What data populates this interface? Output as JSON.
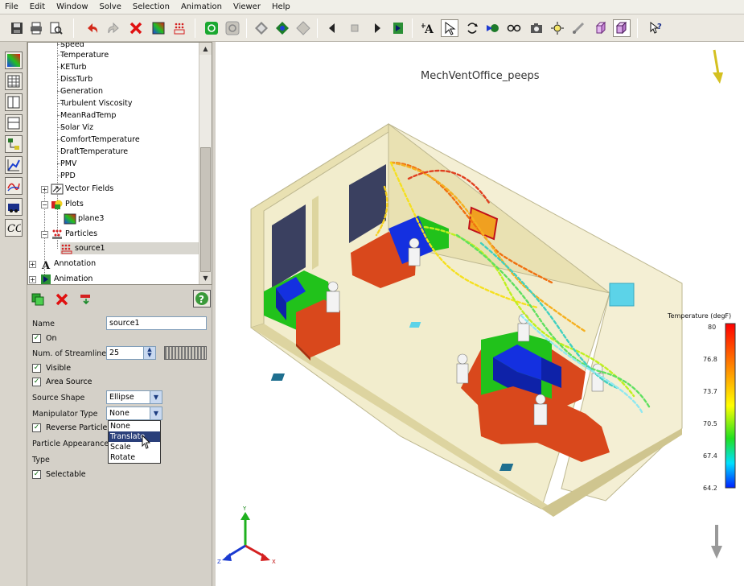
{
  "menu": [
    "File",
    "Edit",
    "Window",
    "Solve",
    "Selection",
    "Animation",
    "Viewer",
    "Help"
  ],
  "tree": {
    "items": [
      {
        "label": "Speed"
      },
      {
        "label": "Temperature"
      },
      {
        "label": "KETurb"
      },
      {
        "label": "DissTurb"
      },
      {
        "label": "Generation"
      },
      {
        "label": "Turbulent Viscosity"
      },
      {
        "label": "MeanRadTemp"
      },
      {
        "label": "Solar Viz"
      },
      {
        "label": "ComfortTemperature"
      },
      {
        "label": "DraftTemperature"
      },
      {
        "label": "PMV"
      },
      {
        "label": "PPD"
      },
      {
        "label": "Vector Fields"
      },
      {
        "label": "Plots"
      },
      {
        "label": "plane3"
      },
      {
        "label": "Particles"
      },
      {
        "label": "source1"
      },
      {
        "label": "Annotation"
      },
      {
        "label": "Animation"
      }
    ]
  },
  "props": {
    "name_label": "Name",
    "name_value": "source1",
    "on_label": "On",
    "streamlines_label": "Num. of Streamlines",
    "streamlines_value": "25",
    "visible_label": "Visible",
    "area_source_label": "Area Source",
    "source_shape_label": "Source Shape",
    "source_shape_value": "Ellipse",
    "manipulator_label": "Manipulator Type",
    "manipulator_value": "None",
    "reverse_label": "Reverse Particle",
    "appearance_label": "Particle Appearance",
    "type_label": "Type",
    "selectable_label": "Selectable",
    "dropdown_options": [
      "None",
      "Translate",
      "Scale",
      "Rotate"
    ],
    "dropdown_highlighted": "Translate"
  },
  "viewport": {
    "title": "MechVentOffice_peeps",
    "legend_title": "Temperature (degF)",
    "legend_ticks": [
      "80",
      "76.8",
      "73.7",
      "70.5",
      "67.4",
      "64.2"
    ],
    "axis_labels": [
      "Y",
      "X",
      "Z"
    ]
  },
  "colors": {
    "accent": "#2a3f7a",
    "floor": "#f2edcd",
    "wall": "#e9e1b2",
    "desk": "#d9481c",
    "chair_blue": "#1430e0",
    "partition_green": "#21c21b"
  }
}
